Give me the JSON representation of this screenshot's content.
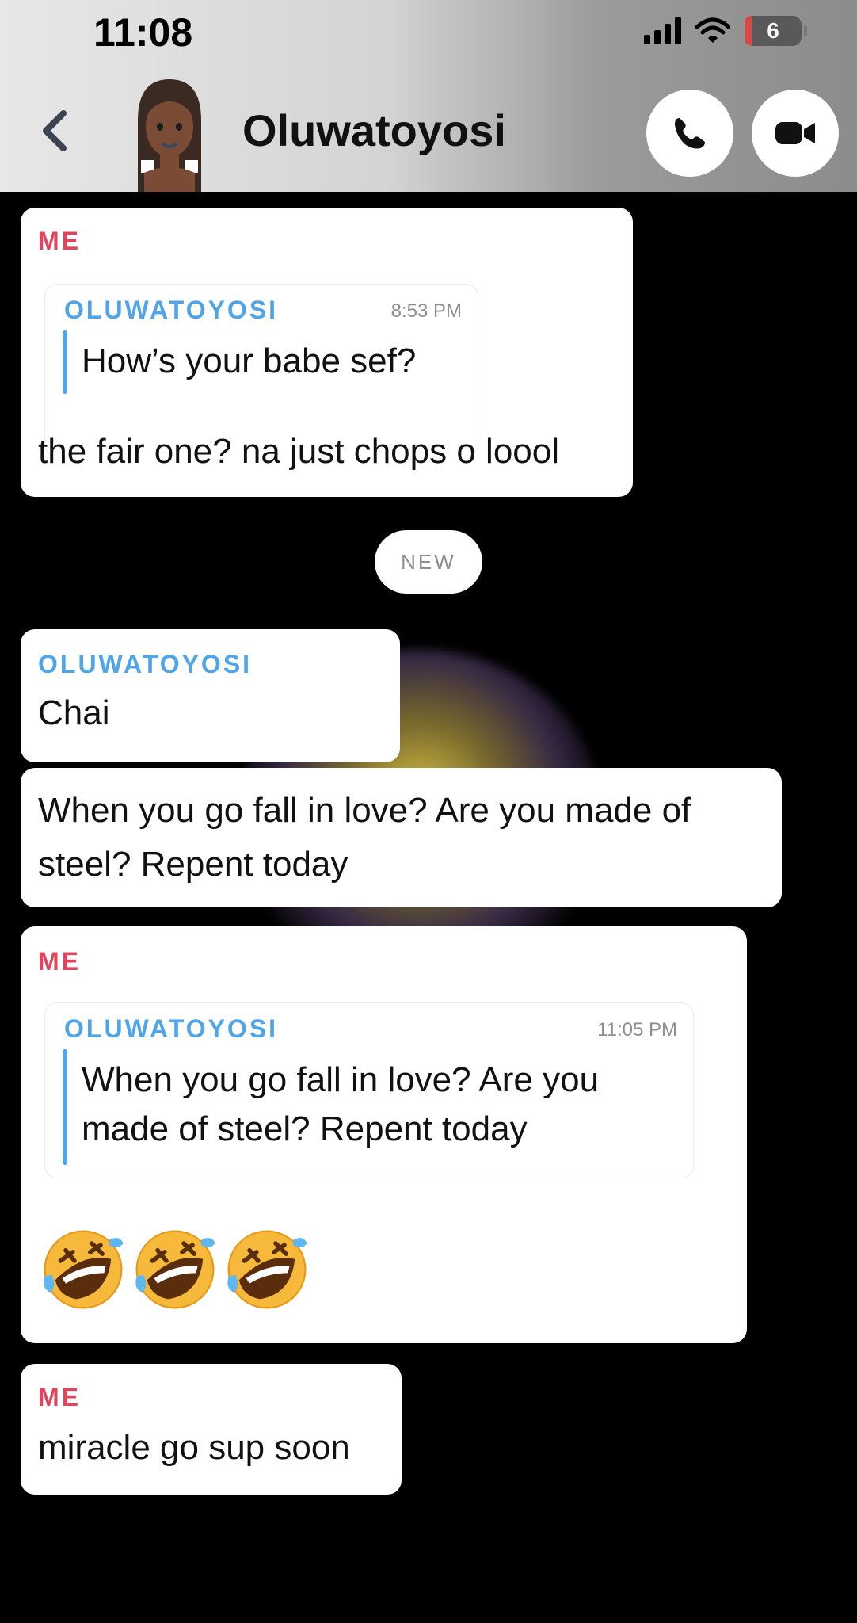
{
  "status_bar": {
    "time": "11:08",
    "battery_level": "6"
  },
  "header": {
    "contact_name": "Oluwatoyosi"
  },
  "divider": {
    "label": "NEW"
  },
  "messages": [
    {
      "sender": "ME",
      "quote": {
        "sender": "OLUWATOYOSI",
        "time": "8:53 PM",
        "text": "How’s your babe sef?"
      },
      "text": "the fair one? na just chops o loool"
    },
    {
      "sender": "OLUWATOYOSI",
      "text": "Chai"
    },
    {
      "text": "When you go fall in love? Are you made of steel? Repent today"
    },
    {
      "sender": "ME",
      "quote": {
        "sender": "OLUWATOYOSI",
        "time": "11:05 PM",
        "text": "When you go fall in love? Are you made of steel? Repent today"
      },
      "emoji": [
        "rolling-on-floor-laughing",
        "rolling-on-floor-laughing",
        "rolling-on-floor-laughing"
      ]
    },
    {
      "sender": "ME",
      "text": "miracle go sup soon"
    }
  ],
  "colors": {
    "me": "#e1445d",
    "them": "#4fa5e8",
    "bubble": "#ffffff",
    "background": "#000000"
  }
}
